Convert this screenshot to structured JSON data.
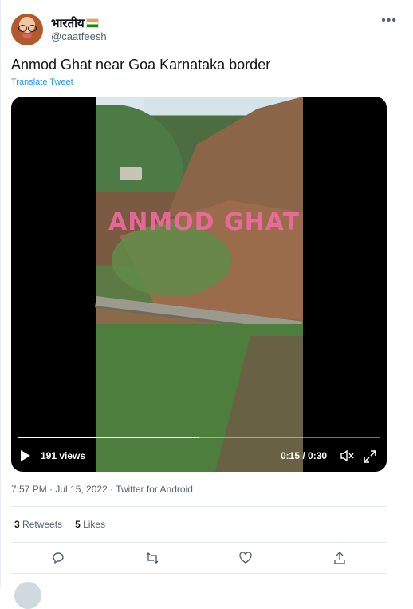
{
  "author": {
    "display_name": "भारतीय",
    "flag_icon": "india-flag-icon",
    "handle": "@caatfeesh"
  },
  "tweet": {
    "text": "Anmod Ghat near Goa Karnataka border",
    "translate_label": "Translate Tweet"
  },
  "video": {
    "watermark": "ANMOD GHAT",
    "views": "191 views",
    "time": "0:15 / 0:30",
    "progress_fraction": 0.5
  },
  "meta": {
    "timestamp": "7:57 PM · Jul 15, 2022 · Twitter for Android"
  },
  "stats": {
    "retweets_count": "3",
    "retweets_label": "Retweets",
    "likes_count": "5",
    "likes_label": "Likes"
  },
  "colors": {
    "accent": "#1d9bf0",
    "secondary_text": "#536471",
    "watermark": "#f06aa1"
  }
}
